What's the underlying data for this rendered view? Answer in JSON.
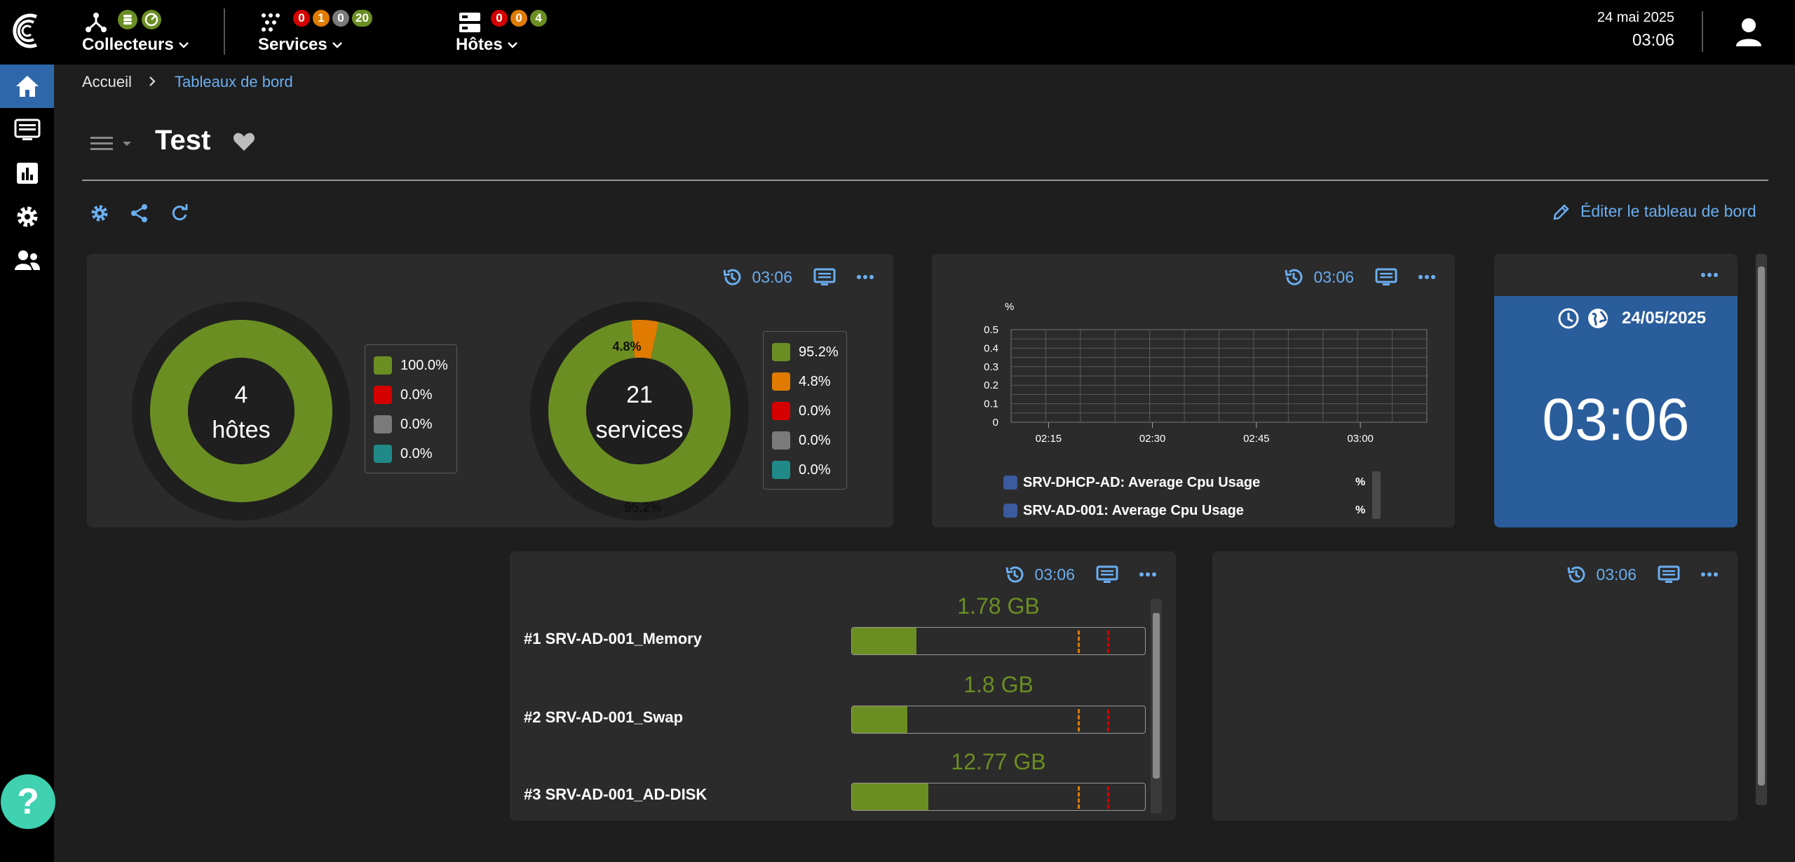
{
  "colors": {
    "accent": "#6aaef0",
    "ok": "#6b8e23",
    "warning": "#e07b00",
    "critical": "#d50000",
    "unknown": "#7a7a7a",
    "pending": "#1f8a87",
    "clock_bg": "#2a5d9c"
  },
  "header": {
    "collectors": {
      "label": "Collecteurs"
    },
    "services": {
      "label": "Services",
      "counts": [
        "0",
        "1",
        "0",
        "20"
      ]
    },
    "hosts": {
      "label": "Hôtes",
      "counts": [
        "0",
        "0",
        "4"
      ]
    },
    "date": "24 mai 2025",
    "time": "03:06"
  },
  "sidebar": {
    "items": [
      "home-icon",
      "monitoring-icon",
      "reporting-icon",
      "configuration-icon",
      "administration-icon"
    ]
  },
  "breadcrumb": {
    "home": "Accueil",
    "current": "Tableaux de bord"
  },
  "dashboard": {
    "title": "Test",
    "edit_label": "Éditer le tableau de bord"
  },
  "widgets": {
    "status": {
      "refresh_time": "03:06",
      "hosts": {
        "count": "4",
        "label": "hôtes",
        "legend": [
          "100.0%",
          "0.0%",
          "0.0%",
          "0.0%"
        ],
        "values": [
          100,
          0,
          0,
          0
        ]
      },
      "services": {
        "count": "21",
        "label": "services",
        "legend": [
          "95.2%",
          "4.8%",
          "0.0%",
          "0.0%",
          "0.0%"
        ],
        "values": [
          95.2,
          4.8,
          0,
          0,
          0
        ],
        "inner_labels": [
          "4.8%",
          "95.2%"
        ]
      }
    },
    "graph": {
      "refresh_time": "03:06",
      "chart_data": {
        "type": "line",
        "ylabel": "%",
        "ylim": [
          0,
          0.5
        ],
        "yticks": [
          "0.5",
          "0.4",
          "0.3",
          "0.2",
          "0.1",
          "0"
        ],
        "xticks": [
          "02:15",
          "02:30",
          "02:45",
          "03:00"
        ],
        "series": [
          {
            "name": "SRV-DHCP-AD: Average Cpu Usage",
            "unit": "%",
            "values": []
          },
          {
            "name": "SRV-AD-001: Average Cpu Usage",
            "unit": "%",
            "values": []
          }
        ]
      }
    },
    "clock": {
      "date": "24/05/2025",
      "time": "03:06"
    },
    "top": {
      "refresh_time": "03:06",
      "rows": [
        {
          "label": "#1 SRV-AD-001_Memory",
          "value": "1.78 GB",
          "fill": 0.22
        },
        {
          "label": "#2 SRV-AD-001_Swap",
          "value": "1.8 GB",
          "fill": 0.19
        },
        {
          "label": "#3 SRV-AD-001_AD-DISK",
          "value": "12.77 GB",
          "fill": 0.26
        }
      ]
    },
    "empty": {
      "refresh_time": "03:06"
    }
  }
}
